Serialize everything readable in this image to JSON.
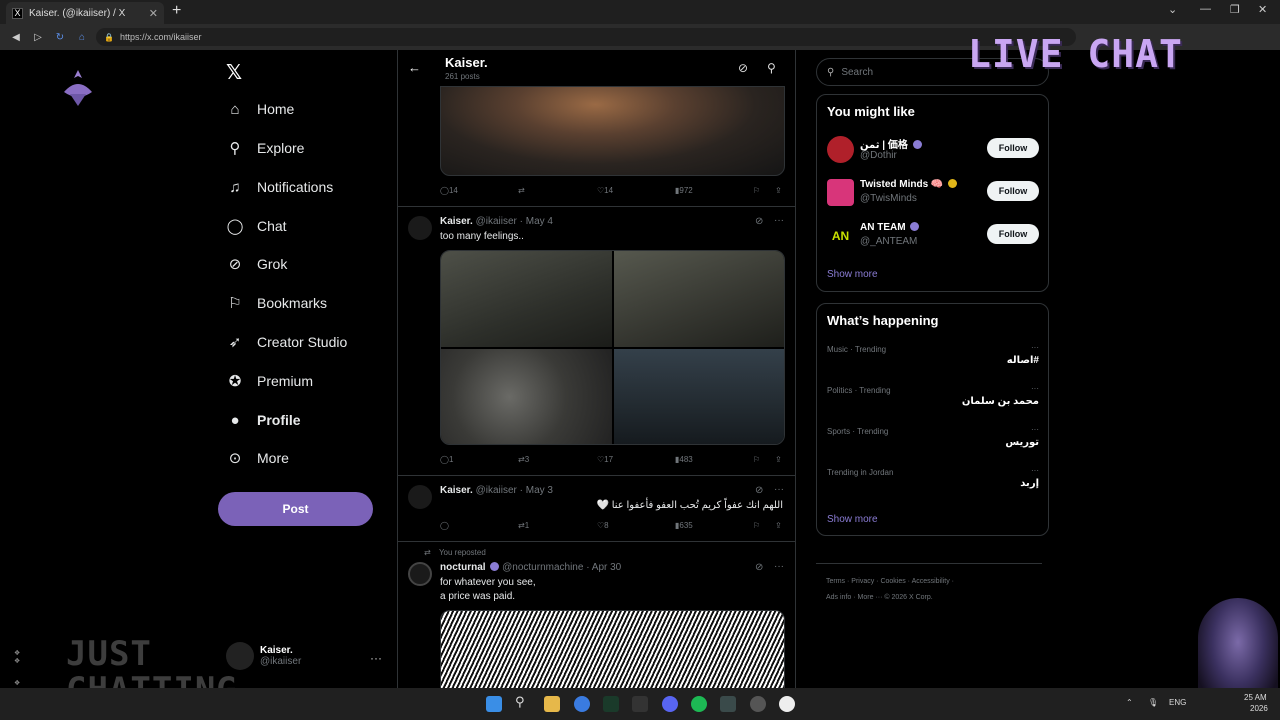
{
  "browser": {
    "tab_title": "Kaiser. (@ikaiiser) / X",
    "tab_favicon": "X",
    "tab_close": "✕",
    "new_tab": "+",
    "url": "https://x.com/ikaiiser"
  },
  "nav": {
    "logo": "𝕏",
    "items": [
      {
        "label": "Home",
        "icon": "home-icon",
        "glyph": "⌂"
      },
      {
        "label": "Explore",
        "icon": "search-icon",
        "glyph": "⚲"
      },
      {
        "label": "Notifications",
        "icon": "bell-icon",
        "glyph": "🔔"
      },
      {
        "label": "Chat",
        "icon": "chat-icon",
        "glyph": "◯"
      },
      {
        "label": "Grok",
        "icon": "grok-icon",
        "glyph": "⊘"
      },
      {
        "label": "Bookmarks",
        "icon": "bookmark-icon",
        "glyph": "⚐"
      },
      {
        "label": "Creator Studio",
        "icon": "rocket-icon",
        "glyph": "➶"
      },
      {
        "label": "Premium",
        "icon": "verified-icon",
        "glyph": "✪"
      },
      {
        "label": "Profile",
        "icon": "person-icon",
        "glyph": "👤"
      },
      {
        "label": "More",
        "icon": "more-circle-icon",
        "glyph": "⊙"
      }
    ],
    "post_label": "Post",
    "account": {
      "name": "Kaiser.",
      "handle": "@ikaiiser",
      "more": "···"
    }
  },
  "header": {
    "name": "Kaiser.",
    "posts_count": "261 posts",
    "back": "←"
  },
  "tweet1_actions": {
    "replies": "14",
    "reposts": "",
    "likes": "14",
    "views": "972"
  },
  "tweet2": {
    "name": "Kaiser.",
    "handle": "@ikaiiser",
    "date": "May 4",
    "text": "too many feelings..",
    "actions": {
      "replies": "1",
      "reposts": "3",
      "likes": "17",
      "views": "483"
    }
  },
  "tweet3": {
    "name": "Kaiser.",
    "handle": "@ikaiiser",
    "date": "May 3",
    "text": "اللهم انك عفواً كريم تُحب العفو فأعفوا عنا 🤍",
    "actions": {
      "replies": "",
      "reposts": "1",
      "likes": "8",
      "views": "635"
    }
  },
  "tweet4": {
    "repost_label": "You reposted",
    "name": "nocturnal",
    "handle": "@nocturnmachine",
    "date": "Apr 30",
    "line1": "for whatever you see,",
    "line2": "a price was paid."
  },
  "search": {
    "placeholder": "Search"
  },
  "might_like": {
    "title": "You might like",
    "users": [
      {
        "name": "ثمن | 価格",
        "handle": "@Dothir",
        "badge_color": "#8a7cd4",
        "avatar_color": "#b0202a"
      },
      {
        "name": "Twisted Minds 🧠",
        "handle": "@TwisMinds",
        "badge_color": "#e2b719",
        "avatar_color": "#d8357a"
      },
      {
        "name": "AN TEAM",
        "handle": "@_ANTEAM",
        "badge_color": "#8a7cd4",
        "avatar_color": "#000000"
      }
    ],
    "follow_label": "Follow",
    "show_more": "Show more"
  },
  "happening": {
    "title": "What’s happening",
    "trends": [
      {
        "category": "Music · Trending",
        "title": "#اصاله"
      },
      {
        "category": "Politics · Trending",
        "title": "محمد بن سلمان"
      },
      {
        "category": "Sports · Trending",
        "title": "توريس"
      },
      {
        "category": "Trending in Jordan",
        "title": "إربد"
      }
    ],
    "show_more": "Show more"
  },
  "footer": {
    "line1": "Terms  ·  Privacy  ·  Cookies  ·  Accessibility  ·",
    "line2": "Ads info  ·  More ···  © 2026 X Corp."
  },
  "overlays": {
    "live_chat": "LIVE CHAT",
    "just": "JUST",
    "chatting": "CHATTING"
  },
  "taskbar": {
    "lang": "ENG",
    "time": "25 AM",
    "date": "2026"
  },
  "colors": {
    "accent": "#7b62b8",
    "link": "#8a7cd4",
    "background": "#000000"
  }
}
